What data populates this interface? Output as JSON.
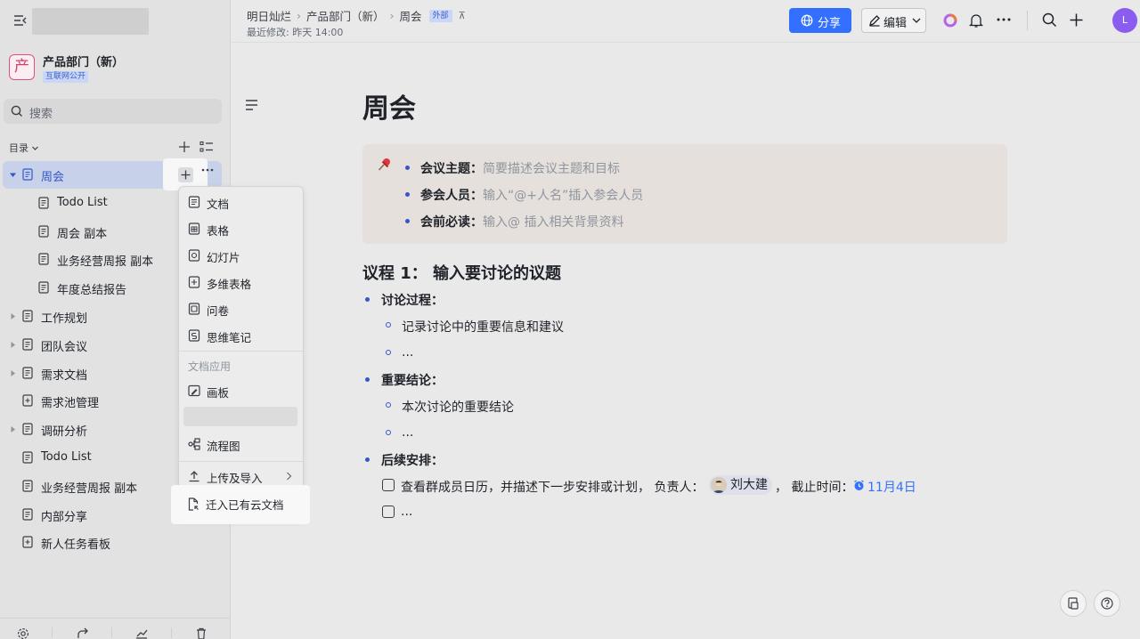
{
  "sidebar": {
    "space": {
      "logo_char": "产",
      "name": "产品部门（新）",
      "badge": "互联网公开"
    },
    "search_placeholder": "搜索",
    "directory_label": "目录",
    "tree": [
      {
        "label": "周会",
        "level": 0,
        "expandable": true,
        "active": true,
        "icon": "doc-icon"
      },
      {
        "label": "Todo List",
        "level": 1,
        "expandable": false,
        "icon": "doc-icon"
      },
      {
        "label": "周会 副本",
        "level": 1,
        "expandable": false,
        "icon": "doc-icon"
      },
      {
        "label": "业务经营周报 副本",
        "level": 1,
        "expandable": false,
        "icon": "doc-icon"
      },
      {
        "label": "年度总结报告",
        "level": 1,
        "expandable": false,
        "icon": "doc-icon"
      },
      {
        "label": "工作规划",
        "level": 0,
        "expandable": true,
        "icon": "doc-icon"
      },
      {
        "label": "团队会议",
        "level": 0,
        "expandable": true,
        "icon": "doc-icon"
      },
      {
        "label": "需求文档",
        "level": 0,
        "expandable": true,
        "icon": "doc-icon"
      },
      {
        "label": "需求池管理",
        "level": 0,
        "expandable": false,
        "icon": "bitable-icon"
      },
      {
        "label": "调研分析",
        "level": 0,
        "expandable": true,
        "icon": "doc-icon"
      },
      {
        "label": "Todo List",
        "level": 0,
        "expandable": false,
        "icon": "doc-icon"
      },
      {
        "label": "业务经营周报 副本",
        "level": 0,
        "expandable": false,
        "icon": "doc-icon"
      },
      {
        "label": "内部分享",
        "level": 0,
        "expandable": false,
        "icon": "doc-icon"
      },
      {
        "label": "新人任务看板",
        "level": 0,
        "expandable": false,
        "icon": "bitable-icon"
      }
    ]
  },
  "menu": {
    "items": [
      {
        "label": "文档",
        "icon": "doc-icon"
      },
      {
        "label": "表格",
        "icon": "sheet-icon"
      },
      {
        "label": "幻灯片",
        "icon": "slides-icon"
      },
      {
        "label": "多维表格",
        "icon": "bitable-icon"
      },
      {
        "label": "问卷",
        "icon": "form-icon"
      },
      {
        "label": "思维笔记",
        "icon": "mindnote-icon"
      }
    ],
    "group_label": "文档应用",
    "board_label": "画板",
    "flowchart_label": "流程图",
    "upload_label": "上传及导入",
    "migrate_label": "迁入已有云文档"
  },
  "topbar": {
    "breadcrumbs": [
      "明日灿烂",
      "产品部门（新）",
      "周会"
    ],
    "external_badge": "外部",
    "last_modified": "最近修改: 昨天 14:00",
    "share_label": "分享",
    "edit_label": "编辑",
    "avatar_initial": "L"
  },
  "doc": {
    "title": "周会",
    "callout": [
      {
        "key": "会议主题",
        "value": "简要描述会议主题和目标"
      },
      {
        "key": "参会人员",
        "value": "输入“@+人名”插入参会人员"
      },
      {
        "key": "会前必读",
        "value": "输入@ 插入相关背景资料"
      }
    ],
    "heading": "议程 1： 输入要讨论的议题",
    "sections": [
      {
        "title": "讨论过程：",
        "items": [
          "记录讨论中的重要信息和建议",
          "..."
        ]
      },
      {
        "title": "重要结论：",
        "items": [
          "本次讨论的重要结论",
          "..."
        ]
      },
      {
        "title": "后续安排：",
        "items": []
      }
    ],
    "todos": [
      {
        "text": "查看群成员日历，并描述下一步安排或计划， 负责人：",
        "assignee": "刘大建",
        "deadline_label": "， 截止时间：",
        "due": "11月4日"
      },
      {
        "text": "..."
      }
    ]
  },
  "colors": {
    "accent": "#3370ff",
    "bullet": "#3456c9",
    "callout_bg": "#e6e0dc",
    "sidebar_active": "#c8d1ea",
    "avatar": "#8a5cf0"
  }
}
